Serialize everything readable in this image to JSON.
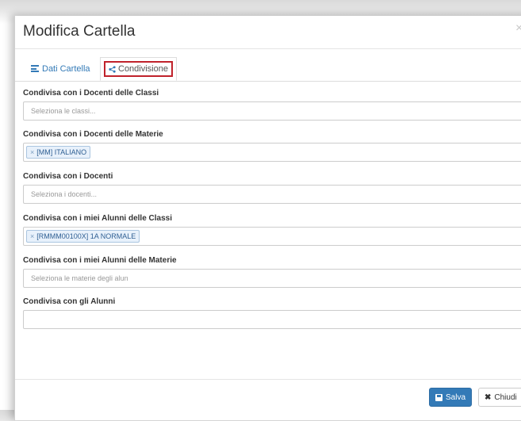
{
  "modal": {
    "title": "Modifica Cartella",
    "close_glyph": "×"
  },
  "tabs": [
    {
      "label": "Dati Cartella",
      "icon": "list-icon",
      "active": false
    },
    {
      "label": "Condivisione",
      "icon": "share-icon",
      "active": true
    }
  ],
  "fields": {
    "docenti_classi": {
      "label": "Condivisa con i Docenti delle Classi",
      "placeholder": "Seleziona le classi..."
    },
    "docenti_materie": {
      "label": "Condivisa con i Docenti delle Materie",
      "tags": [
        "[MM] ITALIANO"
      ]
    },
    "docenti": {
      "label": "Condivisa con i Docenti",
      "placeholder": "Seleziona i docenti..."
    },
    "alunni_classi": {
      "label": "Condivisa con i miei Alunni delle Classi",
      "tags": [
        "[RMMM00100X] 1A NORMALE"
      ]
    },
    "alunni_materie": {
      "label": "Condivisa con i miei Alunni delle Materie",
      "placeholder": "Seleziona le materie degli alun"
    },
    "alunni": {
      "label": "Condivisa con gli Alunni",
      "placeholder": ""
    }
  },
  "footer": {
    "save_label": "Salva",
    "close_label": "Chiudi"
  },
  "colors": {
    "accent": "#337ab7",
    "highlight_border": "#c0222b"
  }
}
